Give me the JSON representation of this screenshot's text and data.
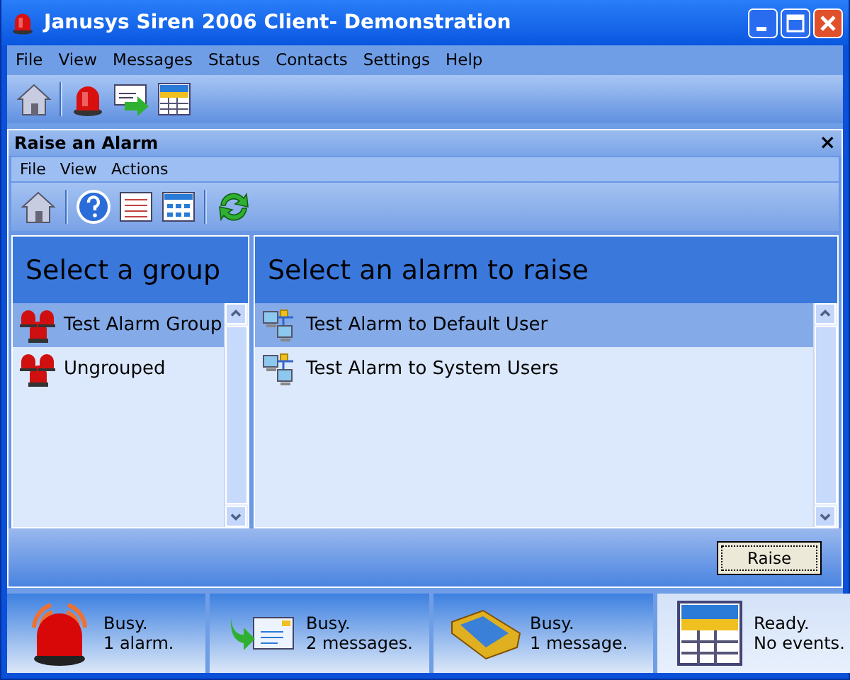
{
  "window": {
    "title": "Janusys Siren 2006 Client- Demonstration"
  },
  "menu": [
    "File",
    "View",
    "Messages",
    "Status",
    "Contacts",
    "Settings",
    "Help"
  ],
  "panel": {
    "title": "Raise an Alarm",
    "close": "×",
    "menu": [
      "File",
      "View",
      "Actions"
    ],
    "groups": {
      "heading": "Select a group",
      "items": [
        {
          "label": "Test Alarm Group",
          "selected": true
        },
        {
          "label": "Ungrouped",
          "selected": false
        }
      ]
    },
    "alarms": {
      "heading": "Select an alarm to raise",
      "items": [
        {
          "label": "Test Alarm to Default User",
          "selected": true
        },
        {
          "label": "Test Alarm to System Users",
          "selected": false
        }
      ]
    },
    "button": "Raise"
  },
  "status_bar": [
    {
      "kind": "alarm",
      "line1": "Busy.",
      "line2": "1 alarm."
    },
    {
      "kind": "outbox",
      "line1": "Busy.",
      "line2": "2 messages."
    },
    {
      "kind": "inbox",
      "line1": "Busy.",
      "line2": "1 message."
    },
    {
      "kind": "calendar",
      "line1": "Ready.",
      "line2": "No events."
    }
  ]
}
